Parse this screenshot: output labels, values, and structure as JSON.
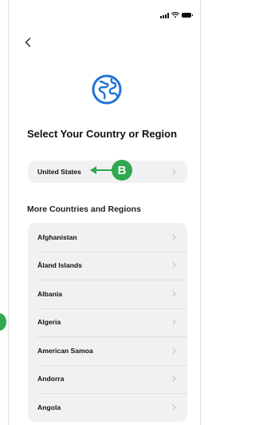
{
  "screen": {
    "title": "Select Your Country or Region",
    "selected_country": "United States",
    "callout_label": "B",
    "section_heading": "More Countries and Regions",
    "countries": [
      "Afghanistan",
      "Åland Islands",
      "Albania",
      "Algeria",
      "American Samoa",
      "Andorra",
      "Angola"
    ]
  },
  "icons": {
    "back": "chevron-left-icon",
    "globe": "globe-icon",
    "row_chevron": "chevron-right-icon",
    "signal": "signal-icon",
    "wifi": "wifi-icon",
    "battery": "battery-icon"
  },
  "colors": {
    "accent_globe": "#1f74d8",
    "callout_green": "#2fa84f",
    "row_background": "#f1f1f3"
  }
}
